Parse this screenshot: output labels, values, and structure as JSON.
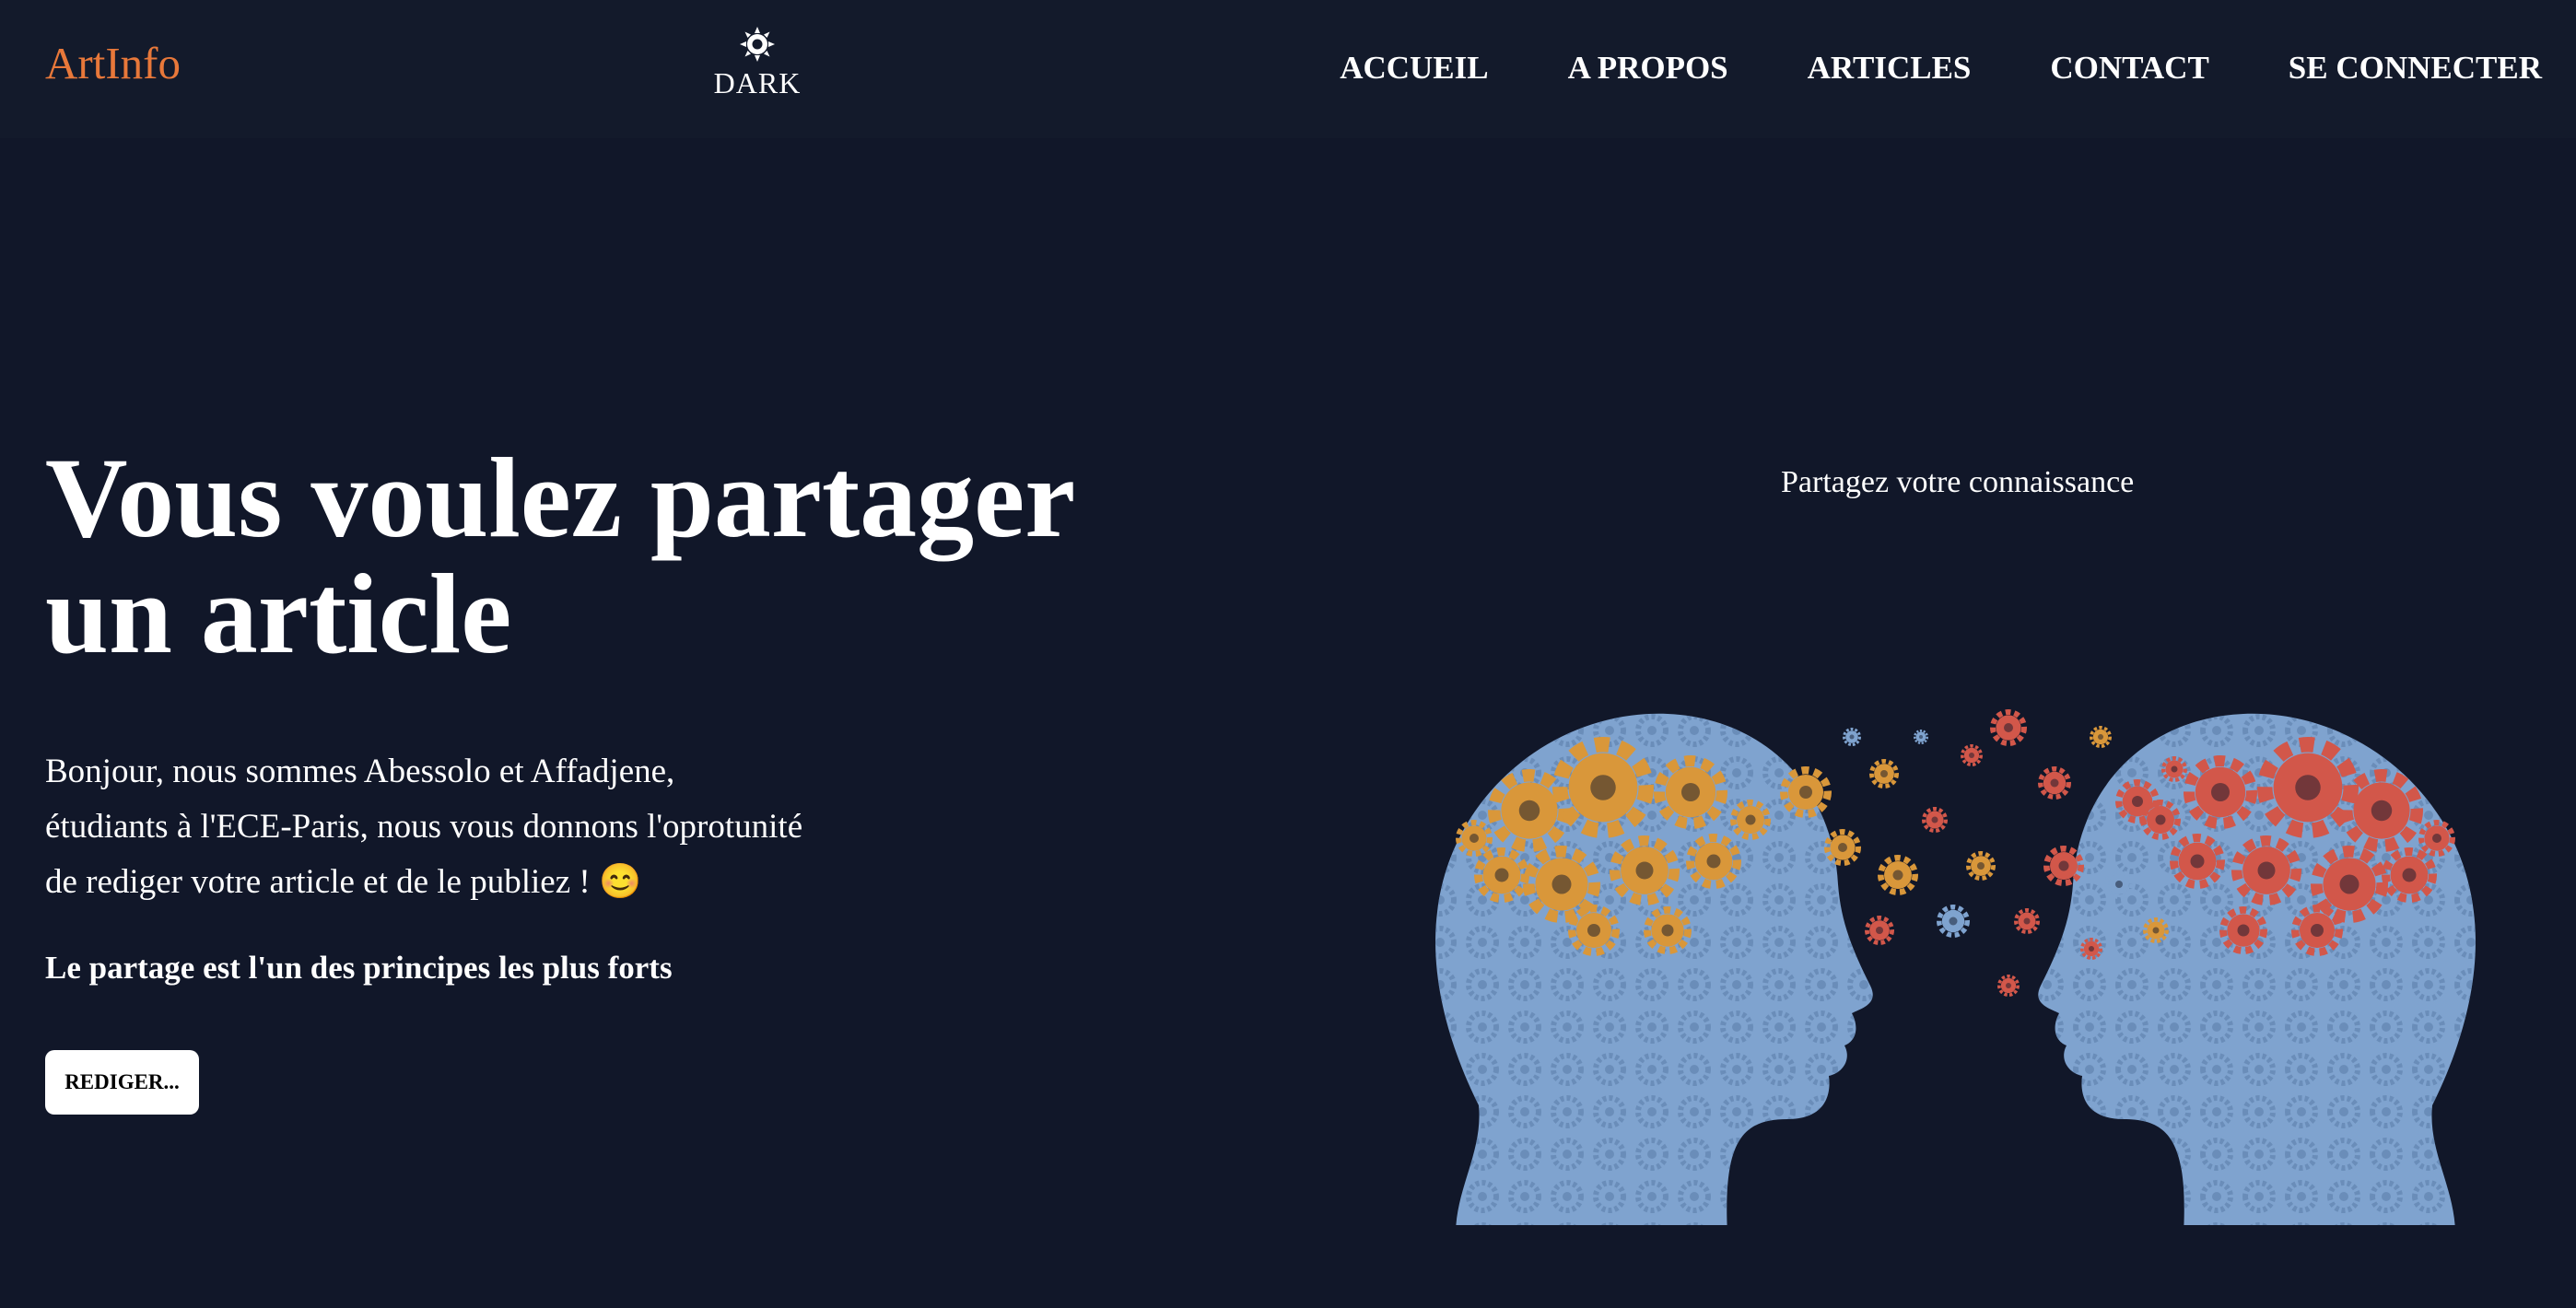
{
  "header": {
    "brand": "ArtInfo",
    "theme_label": "DARK",
    "theme_icon": "sun-icon",
    "nav": [
      "ACCUEIL",
      "A PROPOS",
      "ARTICLES",
      "CONTACT",
      "SE CONNECTER"
    ]
  },
  "hero": {
    "title_line1": "Vous voulez partager",
    "title_line2": "un article",
    "text_line1": "Bonjour, nous sommes Abessolo et Affadjene,",
    "text_line2": "étudiants à l'ECE-Paris, nous vous donnons l'oprotunité",
    "text_line3": "de rediger votre article et de le publiez ! 😊",
    "strong": "Le partage est l'un des principes les plus forts",
    "button": "REDIGER..."
  },
  "image": {
    "caption": "Partagez votre connaissance",
    "alt_icon": "heads-with-gears-illustration"
  },
  "colors": {
    "background": "#111729",
    "header": "#131a2b",
    "brand": "#e8783a",
    "text": "#ffffff",
    "button_bg": "#ffffff",
    "gear_orange": "#d9973a",
    "gear_red": "#d2574a",
    "gear_blue": "#7fa3cf"
  }
}
